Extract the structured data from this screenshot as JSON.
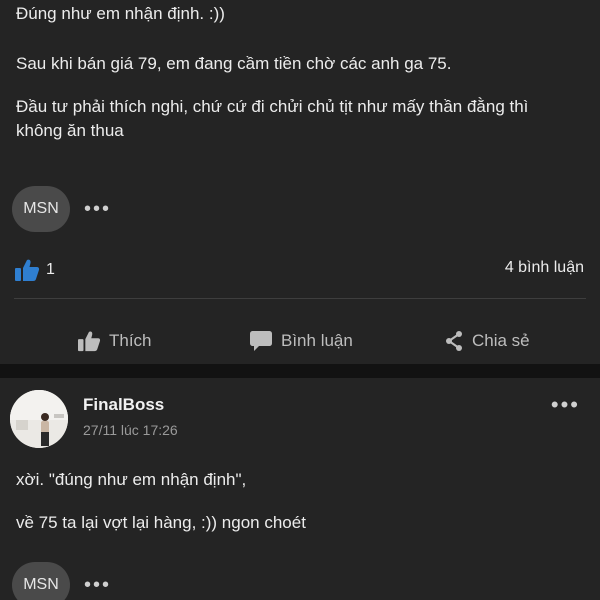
{
  "post1": {
    "line1": "Đúng như em nhận định. :))",
    "line2": "Sau khi bán giá 79, em đang cầm tiền chờ các anh ga 75.",
    "line3a": "Đầu tư phải thích nghi, chứ cứ đi chửi chủ tịt như mấy thần đằng thì",
    "line3b": "không ăn thua",
    "tag": "MSN",
    "more": "•••",
    "like_count": "1",
    "comment_count": "4 bình luận",
    "actions": {
      "like": "Thích",
      "comment": "Bình luận",
      "share": "Chia sẻ"
    }
  },
  "post2": {
    "author": "FinalBoss",
    "time": "27/11 lúc 17:26",
    "line1": "xời. \"đúng như em nhận định\",",
    "line2": "về 75 ta lại vợt lại hàng, :)) ngon choét",
    "tag": "MSN",
    "more": "•••",
    "menu": "•••"
  },
  "colors": {
    "accent_blue": "#2f7fd1",
    "card_bg": "#242424",
    "separator_bg": "#121212"
  }
}
